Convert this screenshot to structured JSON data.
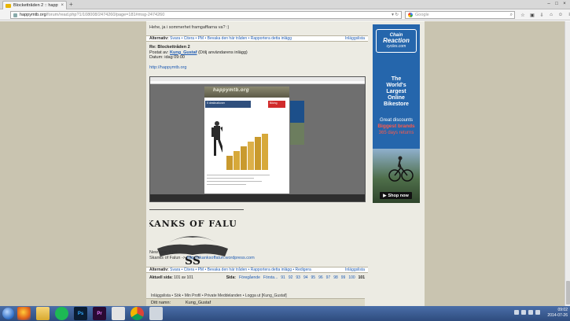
{
  "browser": {
    "tab_title": "Blockettråden 2 :: happymtb.org",
    "tab_close": "×",
    "new_tab": "+",
    "window_controls": [
      "–",
      "□",
      "×"
    ],
    "url_host": "happymtb.org",
    "url_path": "/forum/read.php?1/108008/2474260/page=181#msg-2474260",
    "url_controls": "▾  ↻",
    "search_placeholder": "Google",
    "search_icon": "magnifier-icon",
    "toolbar_icons": [
      "☆",
      "▣",
      "⇩",
      "⌂",
      "☺",
      "≡"
    ]
  },
  "thread": {
    "prev_post_text": "Hehe, ja i sommerhet framgaffiarna va? :)",
    "actions_top": {
      "label": "Alternativ:",
      "items": "Svara • Citera • PM • Bevaka den här tråden • Rapportera detta inlägg",
      "right": "Inläggslista"
    },
    "post": {
      "subject": "Re: Blockettråden 2",
      "posted_by_label": "Postat av:",
      "author": "Kung_Gustaf",
      "hide_text": "(Dölj användarens inlägg)",
      "date": "Datum: idag 09:00",
      "link": "http://happymtb.org"
    },
    "embed": {
      "logo": "happymtb.org",
      "ad_text": "5 destinationer",
      "ad_brand": "Biking"
    },
    "signature": {
      "logo_text_top": "SKANKS OF FALUN",
      "logo_text_bottom": "SS",
      "line1": "New post 8 juli",
      "line2_prefix": "Skanks of Falun -> ",
      "line2_link": "http://skanksoffalun.wordpress.com"
    },
    "actions_bottom": {
      "label": "Alternativ:",
      "items": "Svara • Citera • PM • Bevaka den här tråden • Rapportera detta inlägg • Redigera",
      "right": "Inläggslista"
    },
    "paging": {
      "current_label": "Aktuell sida:",
      "current_value": "101 av 101",
      "pages_label": "Sida:",
      "prev": "Föregående",
      "first": "Första...",
      "pages": [
        "91",
        "92",
        "93",
        "94",
        "95",
        "96",
        "97",
        "98",
        "99",
        "100"
      ],
      "active_page": "101"
    },
    "footer_links": "Inläggslista • Sök • Min Profil • Private Meddelanden • Logga ut [Kung_Gustaf]",
    "footer_name_label": "Ditt namn:",
    "footer_name_value": "Kung_Gustaf"
  },
  "ad": {
    "logo_top": "Chain",
    "logo_mid": "Reaction",
    "logo_bottom": "cycles.com",
    "headline": [
      "The",
      "World's",
      "Largest",
      "Online",
      "Bikestore"
    ],
    "offer": [
      "Great discounts",
      "Biggest brands",
      "365 days returns"
    ],
    "button": "Shop now",
    "colors": {
      "bg": "#2566ac",
      "accent": "#ff5a4a",
      "text": "#ffffff"
    }
  },
  "taskbar": {
    "icons": [
      {
        "name": "start-orb",
        "label": ""
      },
      {
        "name": "firefox-icon",
        "label": ""
      },
      {
        "name": "explorer-icon",
        "label": ""
      },
      {
        "name": "spotify-icon",
        "label": ""
      },
      {
        "name": "steam-icon",
        "label": ""
      },
      {
        "name": "photoshop-icon",
        "label": "Ps"
      },
      {
        "name": "premiere-icon",
        "label": "Pr"
      },
      {
        "name": "app-icon",
        "label": ""
      },
      {
        "name": "chrome-icon",
        "label": ""
      },
      {
        "name": "recycle-icon",
        "label": ""
      }
    ],
    "clock_time": "09:02",
    "clock_date": "2014-07-26"
  }
}
